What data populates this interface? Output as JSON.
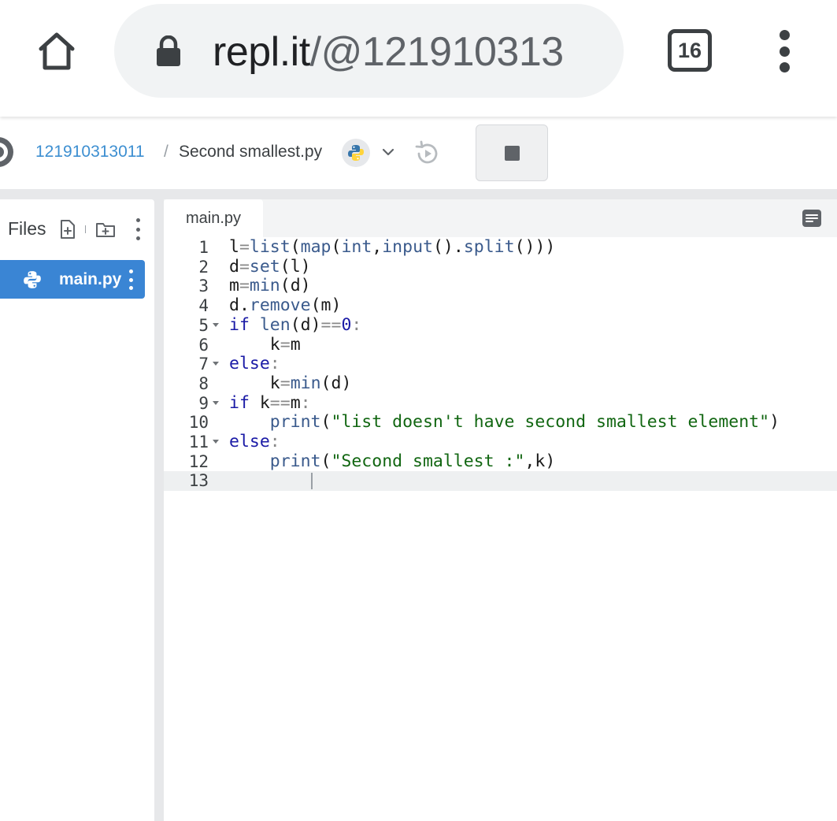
{
  "browser": {
    "url_host": "repl.it",
    "url_path": "/@121910313",
    "tab_count": "16"
  },
  "header": {
    "username": "121910313011",
    "separator": "/",
    "filename": "Second smallest.py"
  },
  "files": {
    "title": "Files",
    "items": [
      {
        "label": "main.py",
        "selected": true
      }
    ]
  },
  "editor": {
    "tab_label": "main.py",
    "active_line": 13,
    "lines": [
      {
        "n": "1",
        "foldable": false,
        "text": "l=list(map(int,input().split()))"
      },
      {
        "n": "2",
        "foldable": false,
        "text": "d=set(l)"
      },
      {
        "n": "3",
        "foldable": false,
        "text": "m=min(d)"
      },
      {
        "n": "4",
        "foldable": false,
        "text": "d.remove(m)"
      },
      {
        "n": "5",
        "foldable": true,
        "text": "if len(d)==0:"
      },
      {
        "n": "6",
        "foldable": false,
        "text": "    k=m"
      },
      {
        "n": "7",
        "foldable": true,
        "text": "else:"
      },
      {
        "n": "8",
        "foldable": false,
        "text": "    k=min(d)"
      },
      {
        "n": "9",
        "foldable": true,
        "text": "if k==m:"
      },
      {
        "n": "10",
        "foldable": false,
        "text": "    print(\"list doesn't have second smallest element\")"
      },
      {
        "n": "11",
        "foldable": true,
        "text": "else:"
      },
      {
        "n": "12",
        "foldable": false,
        "text": "    print(\"Second smallest :\",k)"
      },
      {
        "n": "13",
        "foldable": false,
        "text": "    "
      }
    ]
  },
  "colors": {
    "accent": "#3a85d4",
    "keyword": "#1a1aa6",
    "string": "#116611"
  }
}
